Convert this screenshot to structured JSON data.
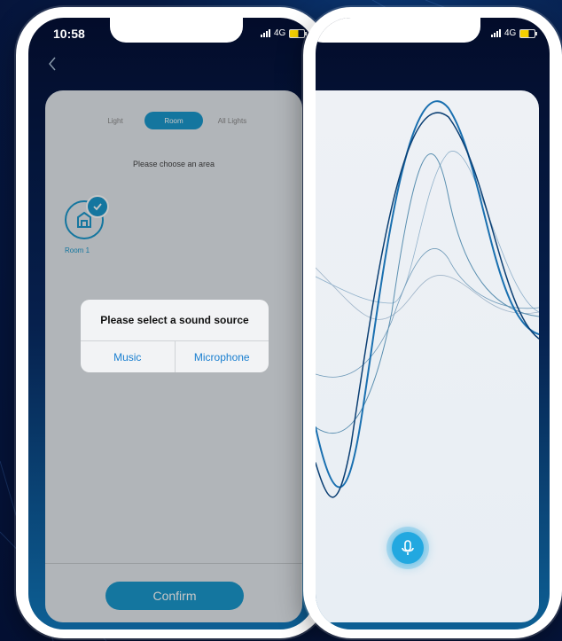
{
  "status_bar": {
    "time": "10:58",
    "network": "4G"
  },
  "left_screen": {
    "tabs": [
      {
        "label": "Light",
        "active": false
      },
      {
        "label": "Room",
        "active": true
      },
      {
        "label": "All Lights",
        "active": false
      }
    ],
    "prompt": "Please choose an area",
    "room": {
      "label": "Room 1",
      "selected": true,
      "icon": "room-icon"
    },
    "confirm_label": "Confirm"
  },
  "dialog": {
    "title": "Please select a sound source",
    "options": [
      "Music",
      "Microphone"
    ]
  },
  "right_screen": {
    "network": "4G",
    "mic_icon": "microphone-icon"
  },
  "colors": {
    "accent": "#1a98cc",
    "dialog_link": "#1a7fd0",
    "background_dark": "#041033"
  }
}
